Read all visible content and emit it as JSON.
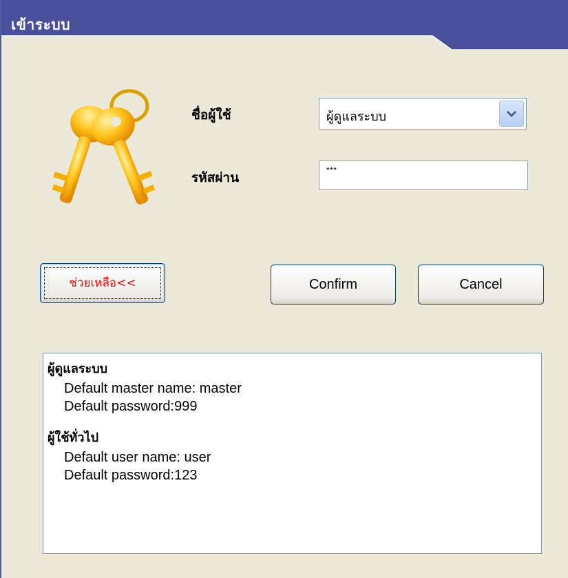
{
  "window": {
    "title": "เข้าระบบ"
  },
  "form": {
    "username_label": "ชื่อผู้ใช้",
    "username_value": "ผู้ดูแลระบบ",
    "password_label": "รหัสผ่าน",
    "password_value": "***"
  },
  "buttons": {
    "help_label": "ช่วยเหลือ<<",
    "confirm_label": "Confirm",
    "cancel_label": "Cancel"
  },
  "info": {
    "admin_heading": "ผู้ดูแลระบบ",
    "admin_name_line": "Default master name: master",
    "admin_password_line": "Default password:999",
    "user_heading": "ผู้ใช้ทั่วไป",
    "user_name_line": "Default user name: user",
    "user_password_line": "Default password:123"
  },
  "icons": {
    "key": "keys-icon",
    "dropdown": "chevron-down-icon"
  },
  "colors": {
    "titlebar": "#4a4f9c",
    "help_text": "#ff0000",
    "background": "#ece9d8"
  }
}
